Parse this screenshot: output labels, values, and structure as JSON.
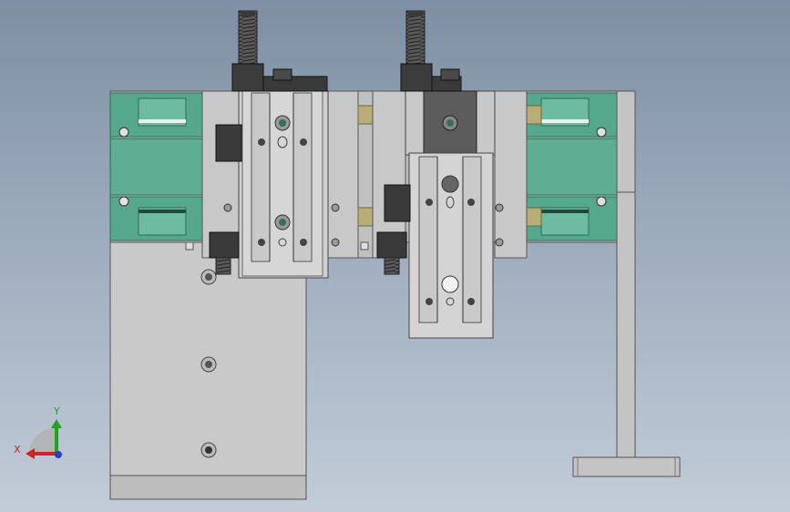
{
  "view": {
    "background_top": "#7e8fa3",
    "background_bottom": "#c3ccd8"
  },
  "triad": {
    "x_label": "X",
    "y_label": "Y",
    "x_color": "#d32020",
    "y_color": "#1fa21f",
    "z_color": "#2040d0"
  },
  "colors": {
    "steel": "#c8c8c8",
    "steel_dark": "#a8a8a8",
    "rail_green": "#55a88c",
    "brass": "#b9ad77",
    "dark": "#3a3a3a"
  }
}
